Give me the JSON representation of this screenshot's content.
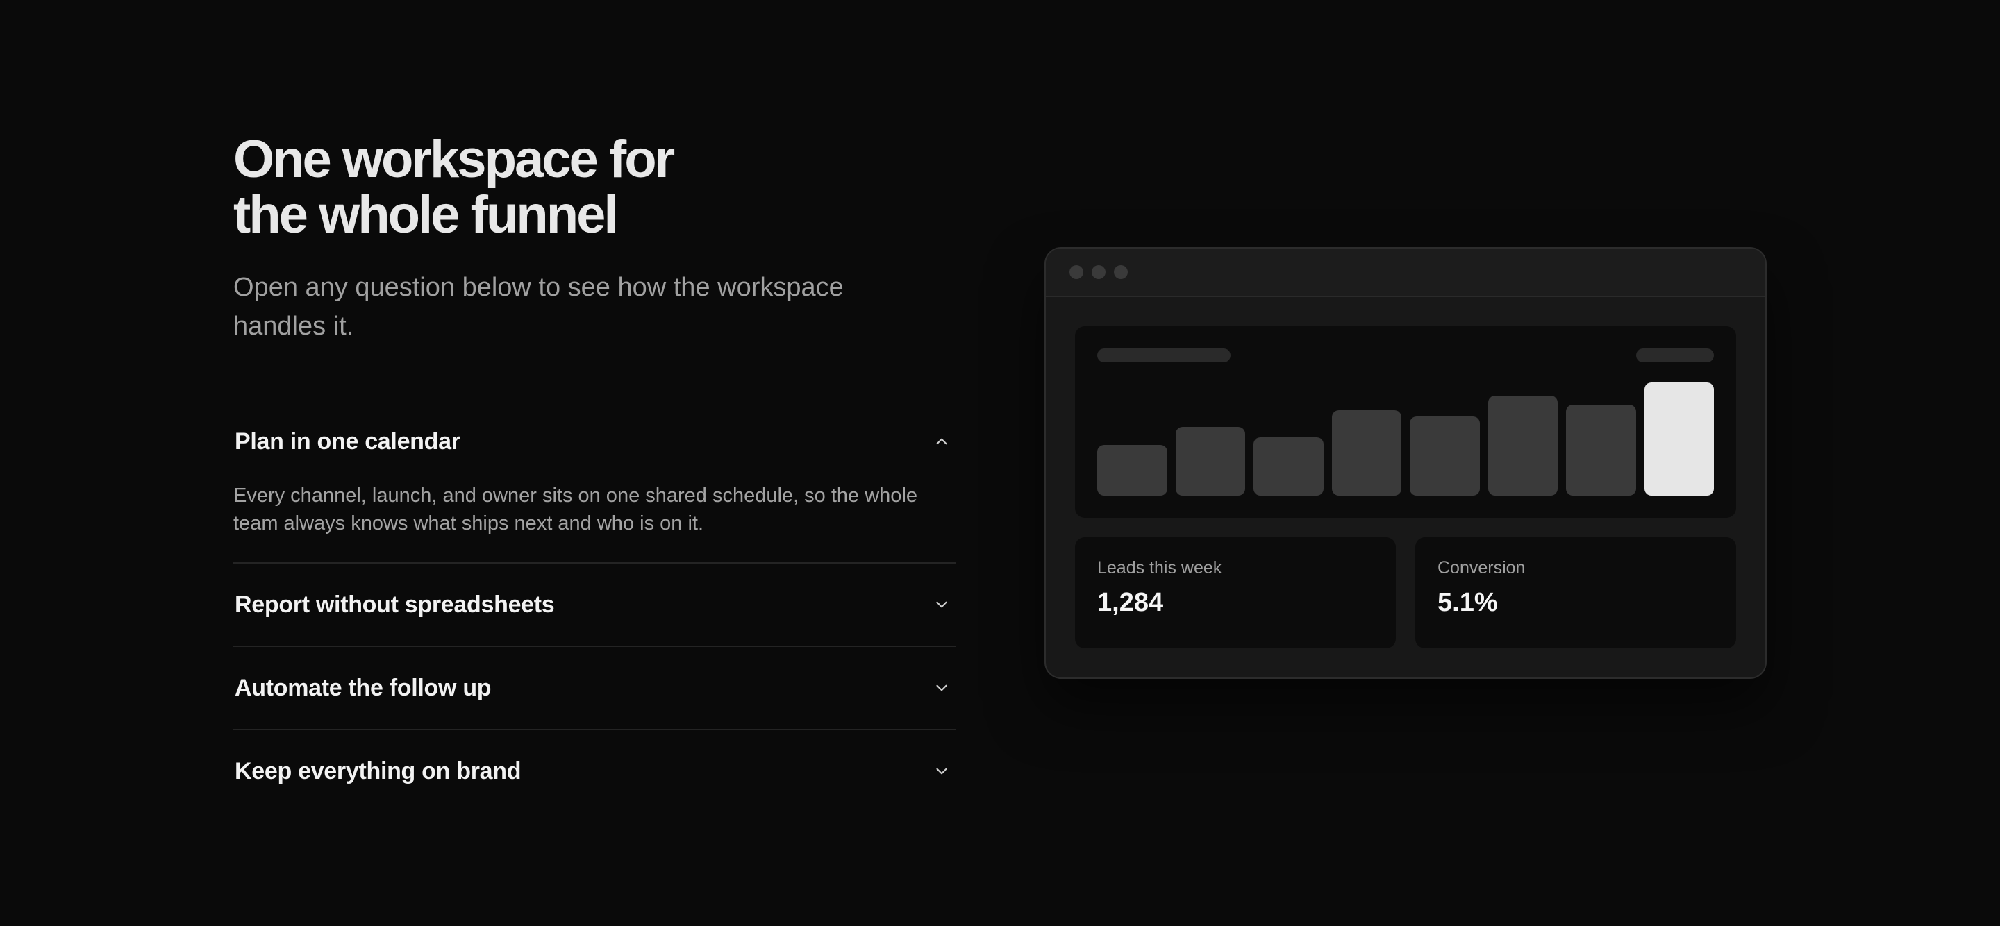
{
  "hero": {
    "headline_line1": "One workspace for",
    "headline_line2": "the whole funnel",
    "subhead": "Open any question below to see how the workspace handles it."
  },
  "accordion": {
    "items": [
      {
        "title": "Plan in one calendar",
        "open": true,
        "body": "Every channel, launch, and owner sits on one shared schedule, so the whole team always knows what ships next and who is on it."
      },
      {
        "title": "Report without spreadsheets",
        "open": false
      },
      {
        "title": "Automate the follow up",
        "open": false
      },
      {
        "title": "Keep everything on brand",
        "open": false
      }
    ]
  },
  "mock": {
    "chart_data": {
      "type": "bar",
      "values": [
        34,
        46,
        39,
        57,
        53,
        67,
        61,
        76
      ],
      "ylim": [
        0,
        80
      ],
      "highlight_index": 7
    },
    "stats": [
      {
        "label": "Leads this week",
        "value": "1,284"
      },
      {
        "label": "Conversion",
        "value": "5.1%"
      }
    ]
  },
  "colors": {
    "background": "#0a0a0a",
    "bar": "#3a3a3a",
    "bar_highlight": "#e6e6e6",
    "muted_text": "#a1a1a1"
  }
}
